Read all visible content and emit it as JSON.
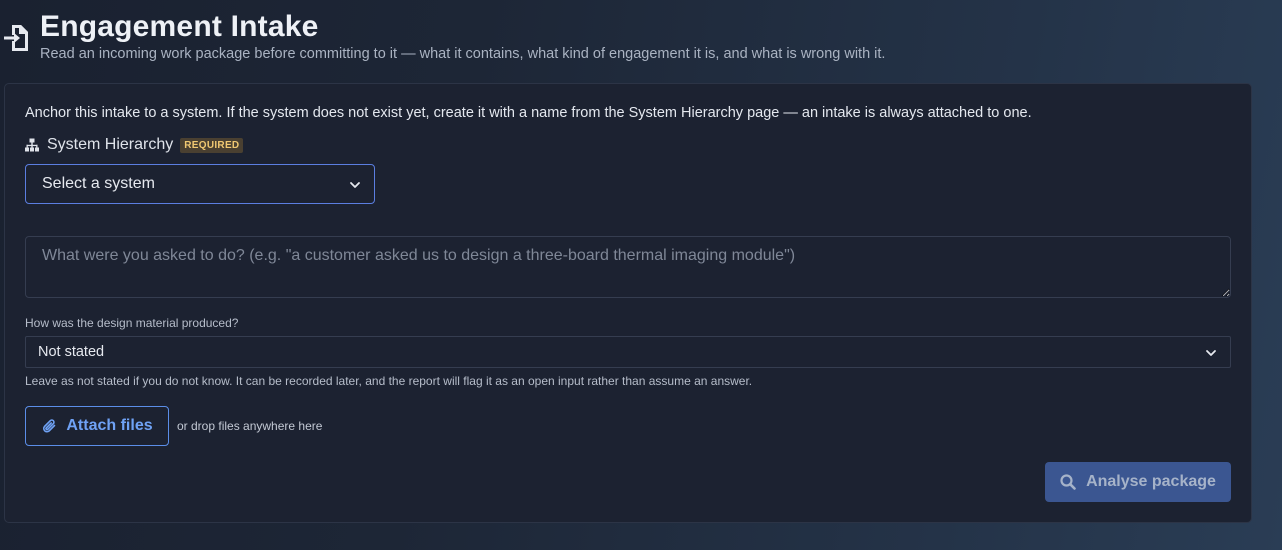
{
  "header": {
    "title": "Engagement Intake",
    "subtitle": "Read an incoming work package before committing to it — what it contains, what kind of engagement it is, and what is wrong with it.",
    "icon": "file-import-icon"
  },
  "panel": {
    "anchor_text": "Anchor this intake to a system. If the system does not exist yet, create it with a name from the System Hierarchy page — an intake is always attached to one.",
    "system_hierarchy": {
      "label": "System Hierarchy",
      "badge": "REQUIRED",
      "icon": "sitemap-icon",
      "select_value": "Select a system"
    },
    "task": {
      "placeholder": "What were you asked to do? (e.g. \"a customer asked us to design a three-board thermal imaging module\")",
      "value": ""
    },
    "design_method": {
      "label": "How was the design material produced?",
      "select_value": "Not stated",
      "help": "Leave as not stated if you do not know. It can be recorded later, and the report will flag it as an open input rather than assume an answer."
    },
    "attach": {
      "label": "Attach files",
      "icon": "paperclip-icon",
      "drop_hint": "or drop files anywhere here"
    },
    "analyse": {
      "label": "Analyse package",
      "icon": "search-icon"
    }
  },
  "colors": {
    "accent": "#5b8ee8",
    "badge_text": "#f0c872",
    "panel_bg": "#1c2231",
    "button_disabled_bg": "#3b5691"
  }
}
